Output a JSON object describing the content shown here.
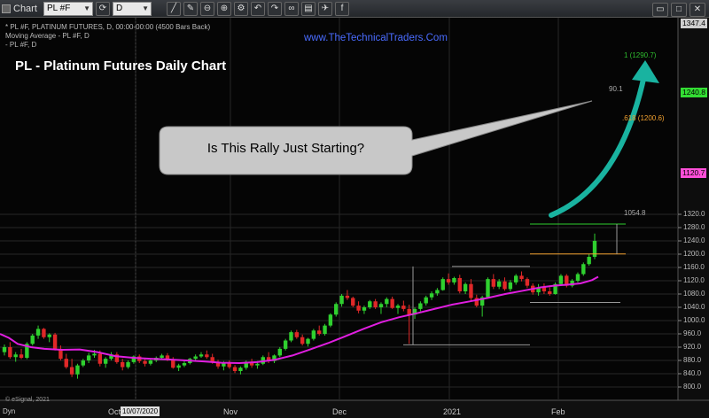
{
  "toolbar": {
    "app_label": "Chart",
    "symbol": "PL #F",
    "interval": "D"
  },
  "chart_info": {
    "line1": "* PL #F, PLATINUM FUTURES, D, 00:00-00:00 (4500 Bars Back)",
    "line2": "Moving Average - PL #F, D",
    "line3": "- PL #F, D"
  },
  "overlay": {
    "title": "PL - Platinum Futures Daily Chart",
    "website": "www.TheTechnicalTraders.Com",
    "callout": "Is This Rally Just Starting?"
  },
  "footer": {
    "esignal": "© eSignal, 2021",
    "mode": "Dyn",
    "date_marker": "10/07/2020"
  },
  "levels": [
    {
      "label": "1 (1290.7)",
      "color": "#2fbf2f"
    },
    {
      "label": ".618 (1200.6)",
      "color": "#f0a030"
    },
    {
      "label": "90.1",
      "color": "#aaaaaa"
    },
    {
      "label": "1054.8",
      "color": "#aaaaaa"
    }
  ],
  "price_tags": [
    {
      "label": "1347.4",
      "color": "#cfcfcf"
    },
    {
      "label": "1240.8",
      "color": "#33dd33"
    },
    {
      "label": "1120.7",
      "color": "#ff4fd8"
    }
  ],
  "chart_data": {
    "type": "candlestick",
    "ylim": [
      780,
      1350
    ],
    "yticks": [
      800,
      840,
      880,
      920,
      960,
      1000,
      1040,
      1080,
      1120,
      1160,
      1200,
      1240,
      1280,
      1320
    ],
    "ytick_labels": [
      "800.0",
      "840.0",
      "880.0",
      "920.0",
      "960.0",
      "1000.0",
      "1040.0",
      "1080.0",
      "1120.0",
      "1160.0",
      "1200.0",
      "1240.0",
      "1280.0",
      "1320.0"
    ],
    "xlabels": [
      "Oct",
      "Nov",
      "Dec",
      "2021",
      "Feb"
    ],
    "colors": {
      "up": "#2fd02f",
      "down": "#e02828",
      "ma": "#e01ee0",
      "arrow": "#19b3a0",
      "grid": "#262626"
    },
    "candles": [
      {
        "o": 905,
        "h": 928,
        "l": 895,
        "c": 920
      },
      {
        "o": 920,
        "h": 935,
        "l": 885,
        "c": 890
      },
      {
        "o": 890,
        "h": 905,
        "l": 876,
        "c": 898
      },
      {
        "o": 898,
        "h": 915,
        "l": 884,
        "c": 888
      },
      {
        "o": 888,
        "h": 935,
        "l": 884,
        "c": 930
      },
      {
        "o": 930,
        "h": 960,
        "l": 925,
        "c": 955
      },
      {
        "o": 955,
        "h": 985,
        "l": 945,
        "c": 975
      },
      {
        "o": 975,
        "h": 978,
        "l": 945,
        "c": 950
      },
      {
        "o": 950,
        "h": 962,
        "l": 935,
        "c": 958
      },
      {
        "o": 958,
        "h": 963,
        "l": 910,
        "c": 915
      },
      {
        "o": 915,
        "h": 925,
        "l": 880,
        "c": 885
      },
      {
        "o": 885,
        "h": 900,
        "l": 855,
        "c": 860
      },
      {
        "o": 860,
        "h": 885,
        "l": 830,
        "c": 838
      },
      {
        "o": 838,
        "h": 870,
        "l": 825,
        "c": 865
      },
      {
        "o": 865,
        "h": 885,
        "l": 860,
        "c": 880
      },
      {
        "o": 880,
        "h": 903,
        "l": 872,
        "c": 895
      },
      {
        "o": 895,
        "h": 912,
        "l": 888,
        "c": 900
      },
      {
        "o": 900,
        "h": 910,
        "l": 862,
        "c": 870
      },
      {
        "o": 870,
        "h": 890,
        "l": 858,
        "c": 885
      },
      {
        "o": 885,
        "h": 905,
        "l": 880,
        "c": 898
      },
      {
        "o": 898,
        "h": 905,
        "l": 870,
        "c": 875
      },
      {
        "o": 875,
        "h": 885,
        "l": 850,
        "c": 860
      },
      {
        "o": 860,
        "h": 880,
        "l": 855,
        "c": 875
      },
      {
        "o": 875,
        "h": 895,
        "l": 870,
        "c": 892
      },
      {
        "o": 892,
        "h": 898,
        "l": 872,
        "c": 878
      },
      {
        "o": 878,
        "h": 885,
        "l": 862,
        "c": 870
      },
      {
        "o": 870,
        "h": 885,
        "l": 865,
        "c": 880
      },
      {
        "o": 880,
        "h": 892,
        "l": 875,
        "c": 888
      },
      {
        "o": 888,
        "h": 900,
        "l": 882,
        "c": 895
      },
      {
        "o": 895,
        "h": 902,
        "l": 878,
        "c": 883
      },
      {
        "o": 883,
        "h": 890,
        "l": 855,
        "c": 858
      },
      {
        "o": 858,
        "h": 870,
        "l": 848,
        "c": 865
      },
      {
        "o": 865,
        "h": 878,
        "l": 860,
        "c": 872
      },
      {
        "o": 872,
        "h": 888,
        "l": 868,
        "c": 885
      },
      {
        "o": 885,
        "h": 898,
        "l": 878,
        "c": 892
      },
      {
        "o": 892,
        "h": 905,
        "l": 888,
        "c": 898
      },
      {
        "o": 898,
        "h": 910,
        "l": 885,
        "c": 890
      },
      {
        "o": 890,
        "h": 900,
        "l": 870,
        "c": 875
      },
      {
        "o": 875,
        "h": 882,
        "l": 855,
        "c": 862
      },
      {
        "o": 862,
        "h": 878,
        "l": 850,
        "c": 872
      },
      {
        "o": 872,
        "h": 880,
        "l": 855,
        "c": 860
      },
      {
        "o": 860,
        "h": 866,
        "l": 842,
        "c": 848
      },
      {
        "o": 848,
        "h": 862,
        "l": 838,
        "c": 858
      },
      {
        "o": 858,
        "h": 880,
        "l": 852,
        "c": 876
      },
      {
        "o": 876,
        "h": 885,
        "l": 858,
        "c": 865
      },
      {
        "o": 865,
        "h": 878,
        "l": 855,
        "c": 870
      },
      {
        "o": 870,
        "h": 895,
        "l": 866,
        "c": 890
      },
      {
        "o": 890,
        "h": 905,
        "l": 872,
        "c": 878
      },
      {
        "o": 878,
        "h": 898,
        "l": 872,
        "c": 895
      },
      {
        "o": 895,
        "h": 920,
        "l": 890,
        "c": 915
      },
      {
        "o": 915,
        "h": 945,
        "l": 910,
        "c": 940
      },
      {
        "o": 940,
        "h": 970,
        "l": 935,
        "c": 965
      },
      {
        "o": 965,
        "h": 972,
        "l": 945,
        "c": 950
      },
      {
        "o": 950,
        "h": 958,
        "l": 925,
        "c": 930
      },
      {
        "o": 930,
        "h": 948,
        "l": 922,
        "c": 945
      },
      {
        "o": 945,
        "h": 975,
        "l": 940,
        "c": 970
      },
      {
        "o": 970,
        "h": 985,
        "l": 955,
        "c": 960
      },
      {
        "o": 960,
        "h": 990,
        "l": 955,
        "c": 985
      },
      {
        "o": 985,
        "h": 1022,
        "l": 980,
        "c": 1018
      },
      {
        "o": 1018,
        "h": 1055,
        "l": 1012,
        "c": 1050
      },
      {
        "o": 1050,
        "h": 1080,
        "l": 1042,
        "c": 1075
      },
      {
        "o": 1075,
        "h": 1092,
        "l": 1062,
        "c": 1068
      },
      {
        "o": 1068,
        "h": 1072,
        "l": 1040,
        "c": 1045
      },
      {
        "o": 1045,
        "h": 1058,
        "l": 1022,
        "c": 1030
      },
      {
        "o": 1030,
        "h": 1045,
        "l": 1020,
        "c": 1040
      },
      {
        "o": 1040,
        "h": 1062,
        "l": 1035,
        "c": 1058
      },
      {
        "o": 1058,
        "h": 1065,
        "l": 1035,
        "c": 1040
      },
      {
        "o": 1040,
        "h": 1055,
        "l": 1020,
        "c": 1050
      },
      {
        "o": 1050,
        "h": 1070,
        "l": 1040,
        "c": 1065
      },
      {
        "o": 1065,
        "h": 1072,
        "l": 1035,
        "c": 1038
      },
      {
        "o": 1038,
        "h": 1050,
        "l": 1020,
        "c": 1045
      },
      {
        "o": 1045,
        "h": 1060,
        "l": 1028,
        "c": 1035
      },
      {
        "o": 1035,
        "h": 1048,
        "l": 930,
        "c": 1018
      },
      {
        "o": 1018,
        "h": 1040,
        "l": 1005,
        "c": 1035
      },
      {
        "o": 1035,
        "h": 1058,
        "l": 1028,
        "c": 1052
      },
      {
        "o": 1052,
        "h": 1075,
        "l": 1045,
        "c": 1070
      },
      {
        "o": 1070,
        "h": 1088,
        "l": 1062,
        "c": 1082
      },
      {
        "o": 1082,
        "h": 1098,
        "l": 1075,
        "c": 1092
      },
      {
        "o": 1092,
        "h": 1130,
        "l": 1090,
        "c": 1125
      },
      {
        "o": 1125,
        "h": 1142,
        "l": 1108,
        "c": 1115
      },
      {
        "o": 1115,
        "h": 1132,
        "l": 1108,
        "c": 1128
      },
      {
        "o": 1128,
        "h": 1138,
        "l": 1082,
        "c": 1088
      },
      {
        "o": 1088,
        "h": 1115,
        "l": 1080,
        "c": 1110
      },
      {
        "o": 1110,
        "h": 1125,
        "l": 1060,
        "c": 1068
      },
      {
        "o": 1068,
        "h": 1078,
        "l": 1040,
        "c": 1045
      },
      {
        "o": 1045,
        "h": 1075,
        "l": 1012,
        "c": 1070
      },
      {
        "o": 1070,
        "h": 1130,
        "l": 1068,
        "c": 1125
      },
      {
        "o": 1125,
        "h": 1140,
        "l": 1095,
        "c": 1102
      },
      {
        "o": 1102,
        "h": 1125,
        "l": 1095,
        "c": 1118
      },
      {
        "o": 1118,
        "h": 1130,
        "l": 1090,
        "c": 1095
      },
      {
        "o": 1095,
        "h": 1122,
        "l": 1088,
        "c": 1115
      },
      {
        "o": 1115,
        "h": 1140,
        "l": 1108,
        "c": 1135
      },
      {
        "o": 1135,
        "h": 1148,
        "l": 1118,
        "c": 1125
      },
      {
        "o": 1125,
        "h": 1130,
        "l": 1098,
        "c": 1105
      },
      {
        "o": 1105,
        "h": 1112,
        "l": 1078,
        "c": 1085
      },
      {
        "o": 1085,
        "h": 1110,
        "l": 1075,
        "c": 1100
      },
      {
        "o": 1100,
        "h": 1112,
        "l": 1080,
        "c": 1088
      },
      {
        "o": 1088,
        "h": 1100,
        "l": 1075,
        "c": 1080
      },
      {
        "o": 1080,
        "h": 1115,
        "l": 1078,
        "c": 1110
      },
      {
        "o": 1110,
        "h": 1140,
        "l": 1105,
        "c": 1135
      },
      {
        "o": 1135,
        "h": 1140,
        "l": 1100,
        "c": 1105
      },
      {
        "o": 1105,
        "h": 1125,
        "l": 1100,
        "c": 1120
      },
      {
        "o": 1120,
        "h": 1145,
        "l": 1115,
        "c": 1140
      },
      {
        "o": 1140,
        "h": 1175,
        "l": 1135,
        "c": 1170
      },
      {
        "o": 1170,
        "h": 1200,
        "l": 1165,
        "c": 1192
      },
      {
        "o": 1192,
        "h": 1262,
        "l": 1185,
        "c": 1240
      }
    ],
    "ma": [
      [
        0,
        960
      ],
      [
        10,
        948
      ],
      [
        20,
        930
      ],
      [
        35,
        920
      ],
      [
        50,
        915
      ],
      [
        70,
        912
      ],
      [
        90,
        913
      ],
      [
        110,
        905
      ],
      [
        130,
        893
      ],
      [
        150,
        888
      ],
      [
        170,
        885
      ],
      [
        190,
        883
      ],
      [
        210,
        880
      ],
      [
        230,
        877
      ],
      [
        250,
        873
      ],
      [
        270,
        872
      ],
      [
        290,
        875
      ],
      [
        310,
        882
      ],
      [
        330,
        895
      ],
      [
        350,
        913
      ],
      [
        370,
        932
      ],
      [
        390,
        953
      ],
      [
        410,
        975
      ],
      [
        430,
        995
      ],
      [
        450,
        1010
      ],
      [
        470,
        1022
      ],
      [
        490,
        1035
      ],
      [
        510,
        1048
      ],
      [
        530,
        1058
      ],
      [
        550,
        1068
      ],
      [
        570,
        1080
      ],
      [
        590,
        1090
      ],
      [
        610,
        1100
      ],
      [
        625,
        1105
      ],
      [
        640,
        1108
      ],
      [
        655,
        1112
      ],
      [
        668,
        1122
      ],
      [
        675,
        1132
      ]
    ],
    "level_lines": [
      {
        "y": 1290.7,
        "x0": 598,
        "x1": 706
      },
      {
        "y": 1200.6,
        "x0": 598,
        "x1": 706
      },
      {
        "y": 1163,
        "x0": 510,
        "x1": 598
      },
      {
        "y": 927,
        "x0": 455,
        "x1": 598
      },
      {
        "y": 1054.8,
        "x0": 598,
        "x1": 700
      }
    ]
  }
}
